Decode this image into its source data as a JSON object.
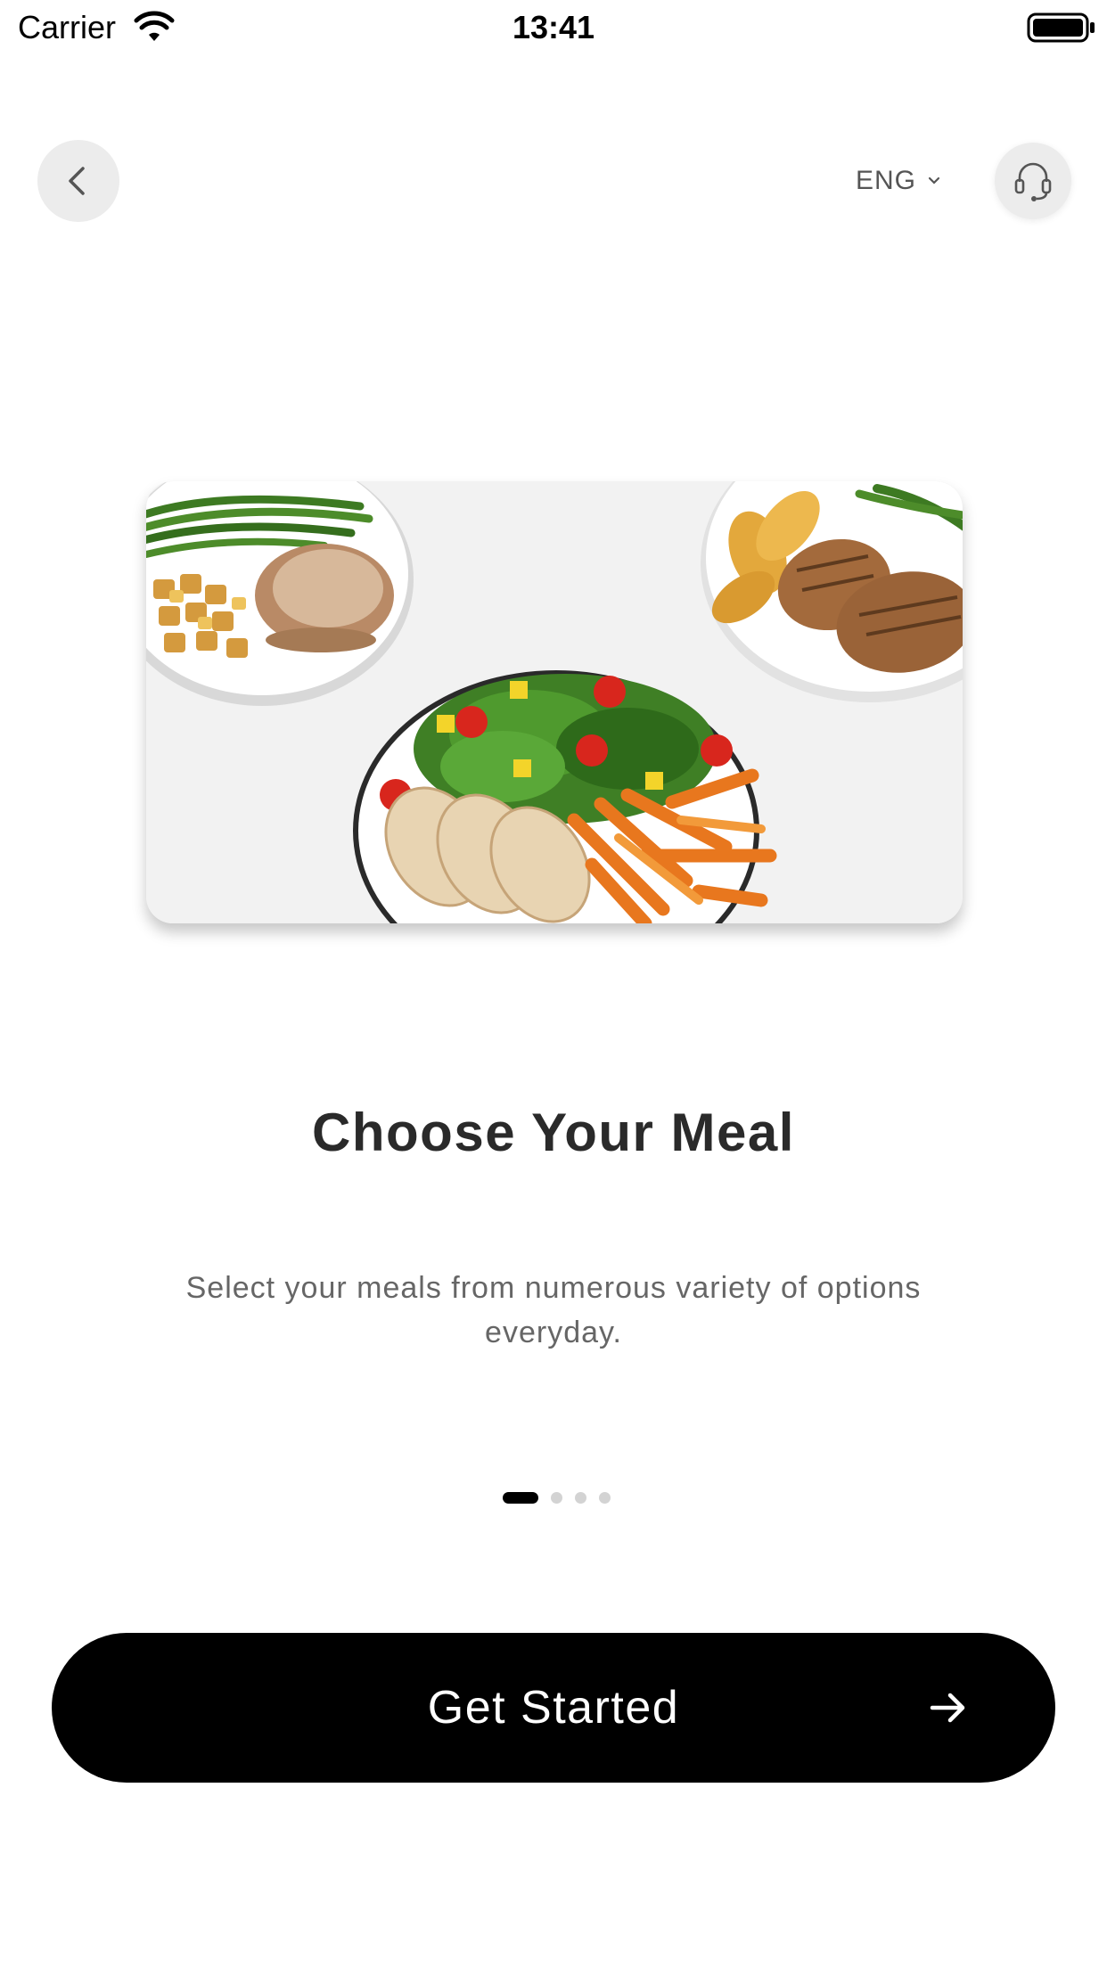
{
  "status_bar": {
    "carrier": "Carrier",
    "time": "13:41"
  },
  "nav": {
    "back_icon": "chevron-left-icon",
    "language": "ENG",
    "language_icon": "chevron-down-icon",
    "support_icon": "headset-icon"
  },
  "hero": {
    "image": "meal-plates-illustration"
  },
  "onboarding": {
    "title": "Choose Your Meal",
    "subtitle": "Select your meals from numerous variety of options everyday.",
    "page_count": 4,
    "active_page": 1
  },
  "cta": {
    "label": "Get Started",
    "icon": "arrow-right-icon"
  },
  "colors": {
    "background": "#ffffff",
    "button": "#000000",
    "button_text": "#ffffff",
    "muted_circle": "#ececec",
    "dot_inactive": "#d3d3d3"
  }
}
